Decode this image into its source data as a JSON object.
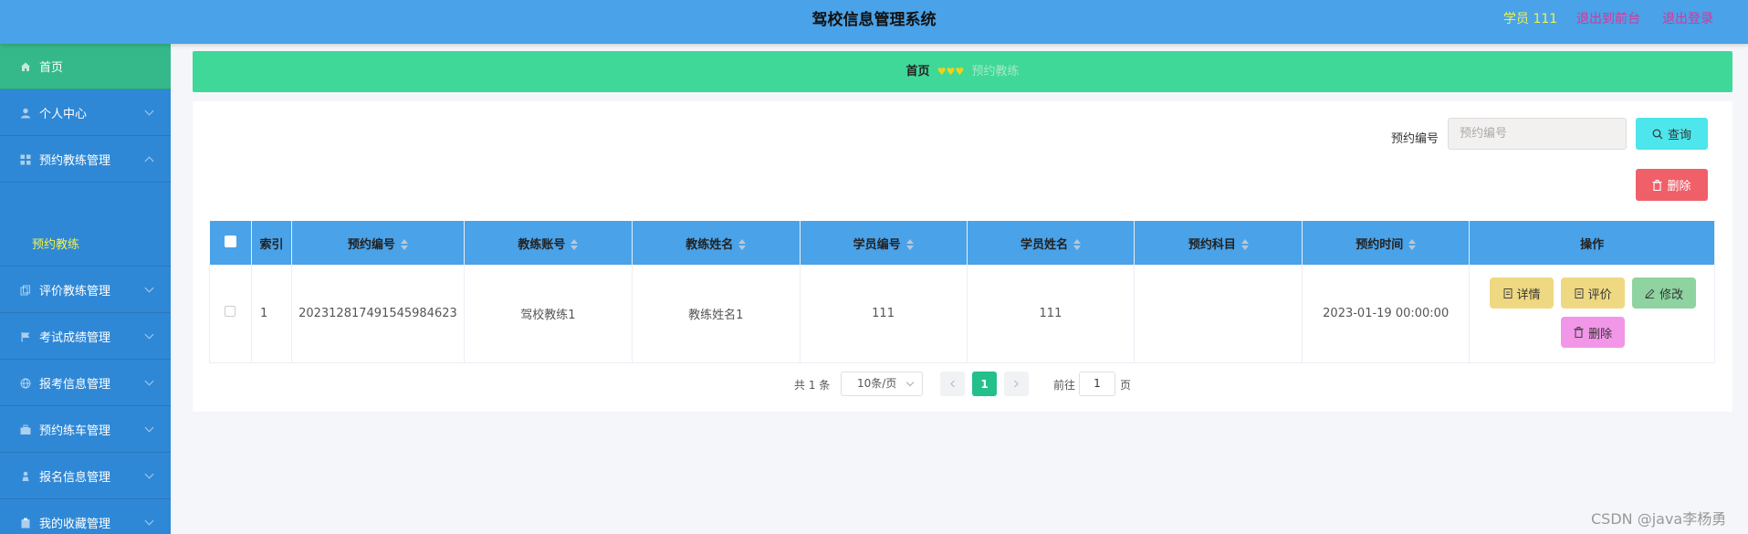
{
  "header": {
    "title": "驾校信息管理系统",
    "user": "学员 111",
    "link_front": "退出到前台",
    "link_logout": "退出登录"
  },
  "sidebar": {
    "items": [
      {
        "label": "首页",
        "icon": "home-icon"
      },
      {
        "label": "个人中心",
        "icon": "user-icon"
      },
      {
        "label": "预约教练管理",
        "icon": "grid-icon"
      },
      {
        "label": "评价教练管理",
        "icon": "copy-icon"
      },
      {
        "label": "考试成绩管理",
        "icon": "flag-icon"
      },
      {
        "label": "报考信息管理",
        "icon": "globe-icon"
      },
      {
        "label": "预约练车管理",
        "icon": "briefcase-icon"
      },
      {
        "label": "报名信息管理",
        "icon": "person-stand-icon"
      },
      {
        "label": "我的收藏管理",
        "icon": "clipboard-icon"
      }
    ],
    "subitem": "预约教练"
  },
  "breadcrumb": {
    "home": "首页",
    "separator": "♥♥♥",
    "current": "预约教练"
  },
  "search": {
    "label": "预约编号",
    "placeholder": "预约编号",
    "query_button": "查询",
    "delete_button": "删除"
  },
  "table": {
    "headers": [
      "索引",
      "预约编号",
      "教练账号",
      "教练姓名",
      "学员编号",
      "学员姓名",
      "预约科目",
      "预约时间",
      "操作"
    ],
    "rows": [
      {
        "index": "1",
        "booking_no": "202312817491545984623",
        "coach_account": "驾校教练1",
        "coach_name": "教练姓名1",
        "student_no": "111",
        "student_name": "111",
        "subject": "",
        "time": "2023-01-19 00:00:00"
      }
    ],
    "actions": {
      "detail": "详情",
      "rate": "评价",
      "edit": "修改",
      "delete": "删除"
    }
  },
  "pagination": {
    "total": "共 1 条",
    "page_size": "10条/页",
    "current_page": "1",
    "goto_prefix": "前往",
    "goto_value": "1",
    "goto_suffix": "页"
  },
  "watermark": "CSDN @java李杨勇",
  "colors": {
    "header": "#4aa2e8",
    "sidebar": "#2f88d6",
    "active_menu": "#35b98a",
    "breadcrumb": "#3fd898",
    "query_button": "#4ce6ec",
    "delete_button": "#ef6069"
  }
}
